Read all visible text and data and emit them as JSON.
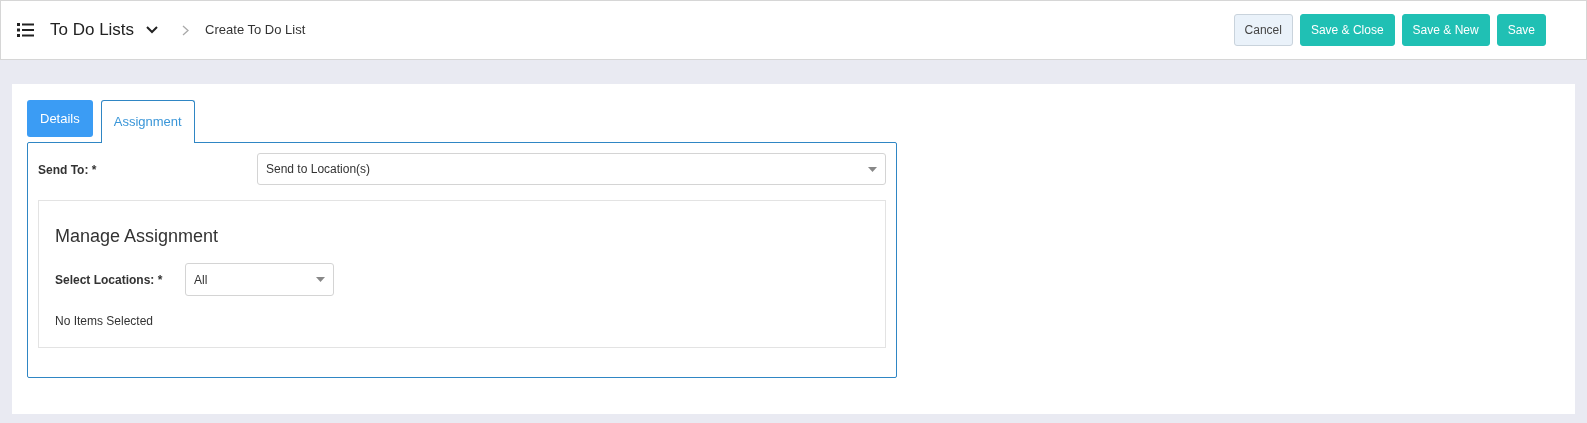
{
  "header": {
    "title": "To Do Lists",
    "breadcrumb": "Create To Do List"
  },
  "actions": [
    {
      "label": "Cancel",
      "kind": "secondary"
    },
    {
      "label": "Save & Close",
      "kind": "primary"
    },
    {
      "label": "Save & New",
      "kind": "primary"
    },
    {
      "label": "Save",
      "kind": "primary"
    }
  ],
  "tabs": [
    {
      "label": "Details",
      "selected": false
    },
    {
      "label": "Assignment",
      "selected": true
    }
  ],
  "send_to": {
    "label": "Send To: *",
    "value": "Send to Location(s)"
  },
  "manage_assignment": {
    "title": "Manage Assignment",
    "select_label": "Select Locations: *",
    "select_value": "All",
    "empty_text": "No Items Selected"
  }
}
